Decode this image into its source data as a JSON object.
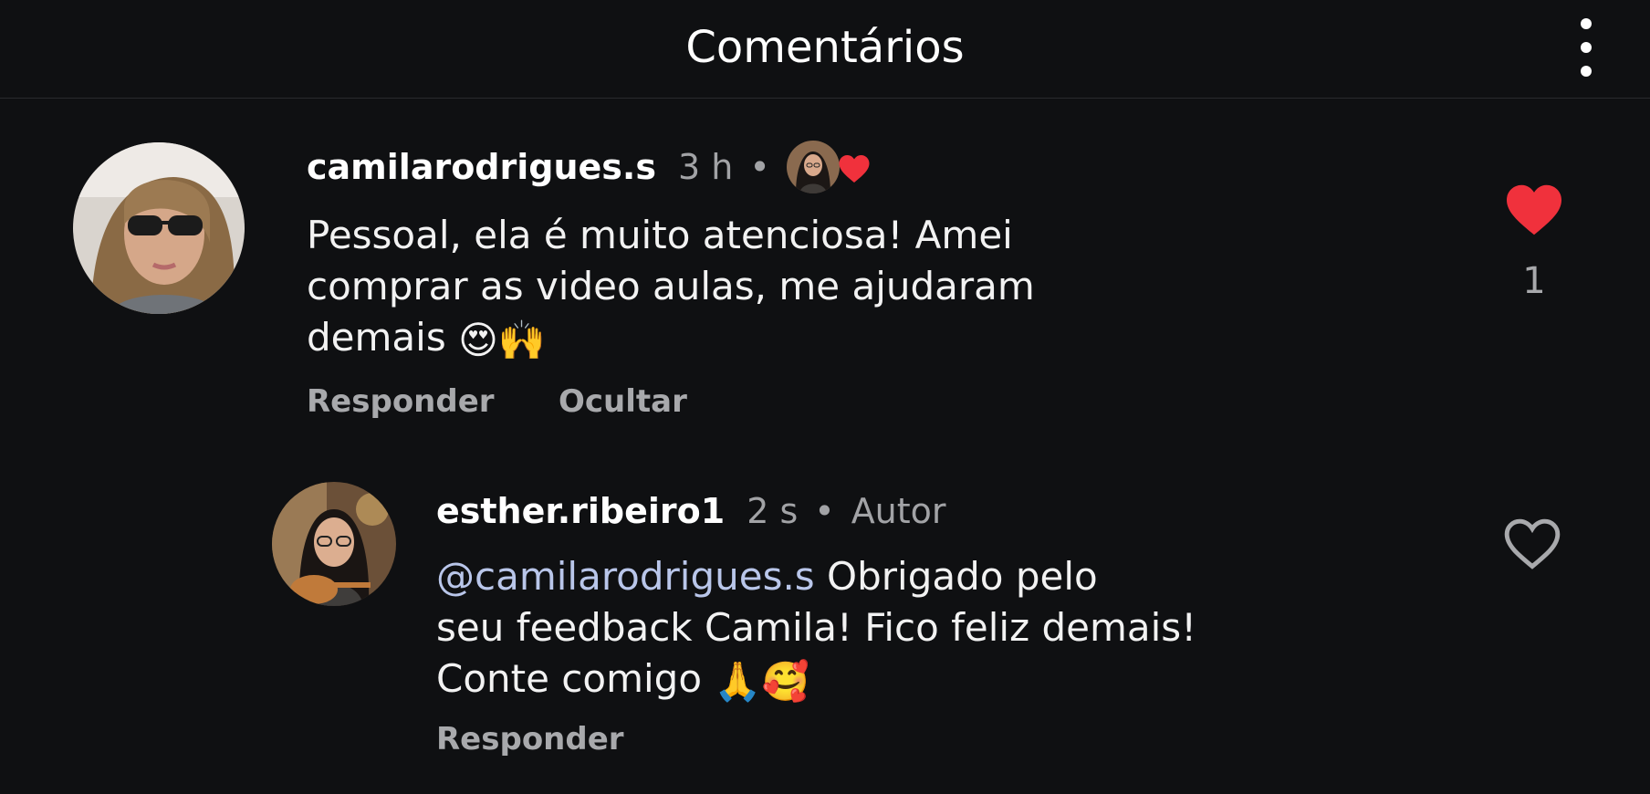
{
  "header": {
    "title": "Comentários",
    "more_icon": "more-vertical-icon"
  },
  "comments": [
    {
      "username": "camilarodrigues.s",
      "time": "3 h",
      "separator": "•",
      "liked_by_author_icon": "heart-icon",
      "text": "Pessoal, ela é muito atenciosa! Amei\ncomprar as video aulas, me ajudaram\ndemais",
      "emojis": [
        "😍",
        "🙌"
      ],
      "actions": {
        "reply": "Responder",
        "hide": "Ocultar"
      },
      "like_icon": "heart-filled-icon",
      "like_count": "1",
      "like_color": "#f0313c"
    },
    {
      "username": "esther.ribeiro1",
      "time": "2 s",
      "separator": "•",
      "badge": "Autor",
      "mention": "@camilarodrigues.s",
      "text": " Obrigado pelo\nseu feedback Camila! Fico feliz demais!\nConte comigo",
      "emojis": [
        "🙏",
        "🥰"
      ],
      "actions": {
        "reply": "Responder"
      },
      "like_icon": "heart-outline-icon"
    }
  ]
}
